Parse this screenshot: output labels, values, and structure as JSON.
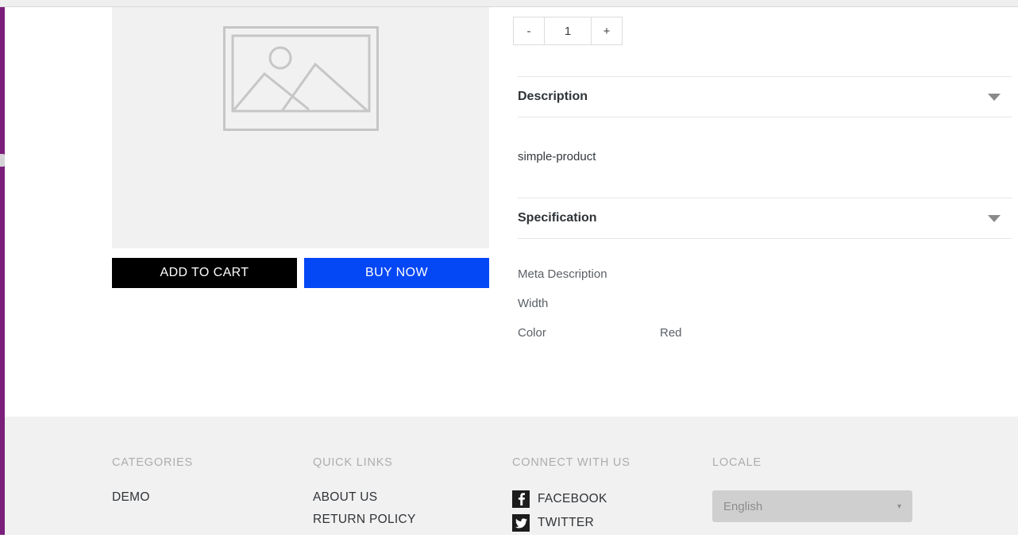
{
  "chrome": {
    "rail_color": "#7b1f7a"
  },
  "gallery": {
    "placeholder_icon": "image-placeholder-icon"
  },
  "actions": {
    "add_to_cart_label": "ADD TO CART",
    "buy_now_label": "BUY NOW",
    "add_to_cart_color": "#000000",
    "buy_now_color": "#0447f5"
  },
  "quantity": {
    "decrement_label": "-",
    "value": "1",
    "increment_label": "+"
  },
  "accordions": [
    {
      "title": "Description",
      "caret": "chevron-down-icon"
    },
    {
      "title": "Specification",
      "caret": "chevron-down-icon"
    }
  ],
  "description": {
    "body": "simple-product"
  },
  "specification": {
    "rows": [
      {
        "key": "Meta Description",
        "value": ""
      },
      {
        "key": "Width",
        "value": ""
      },
      {
        "key": "Color",
        "value": "Red"
      }
    ]
  },
  "footer": {
    "columns": [
      {
        "heading": "CATEGORIES",
        "links": [
          "DEMO"
        ]
      },
      {
        "heading": "QUICK LINKS",
        "links": [
          "ABOUT US",
          "RETURN POLICY"
        ]
      },
      {
        "heading": "CONNECT WITH US",
        "social": [
          {
            "label": "FACEBOOK",
            "icon": "facebook-icon",
            "glyph": "f"
          },
          {
            "label": "TWITTER",
            "icon": "twitter-icon",
            "glyph": "ᵦ"
          }
        ]
      },
      {
        "heading": "LOCALE",
        "locale_selected": "English",
        "locale_caret": "▾"
      }
    ]
  }
}
